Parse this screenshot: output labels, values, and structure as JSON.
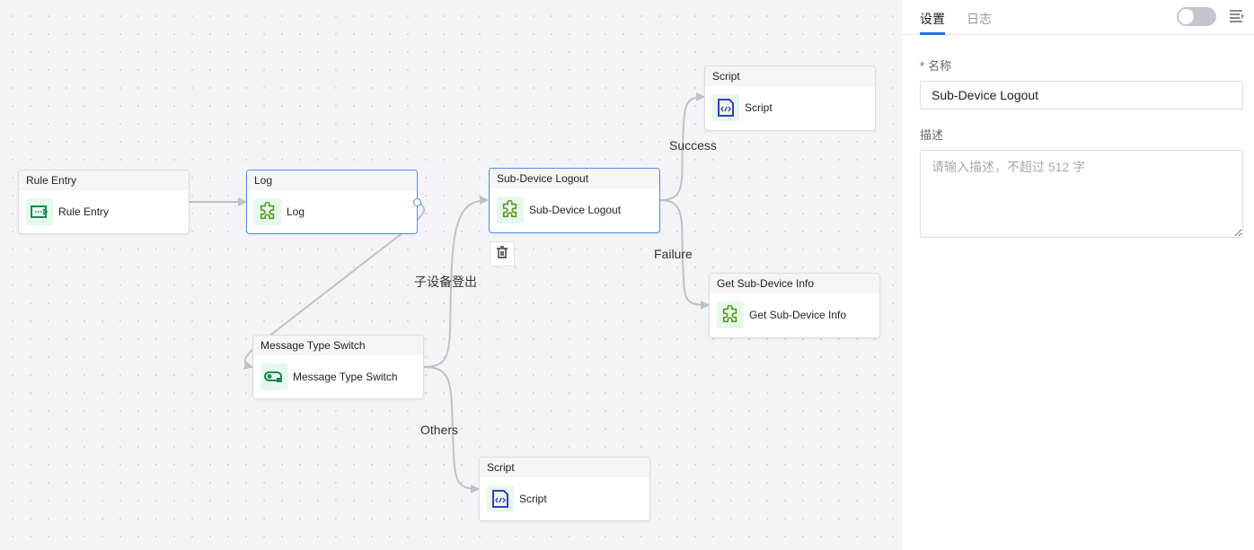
{
  "canvas": {
    "nodes": [
      {
        "id": "rule-entry",
        "title": "Rule Entry",
        "label": "Rule Entry",
        "icon": "rule-entry-icon",
        "selected": false
      },
      {
        "id": "log",
        "title": "Log",
        "label": "Log",
        "icon": "puzzle-icon",
        "selected": false
      },
      {
        "id": "sub-device-logout",
        "title": "Sub-Device Logout",
        "label": "Sub-Device Logout",
        "icon": "puzzle-icon",
        "selected": true
      },
      {
        "id": "script-top",
        "title": "Script",
        "label": "Script",
        "icon": "script-icon",
        "selected": false
      },
      {
        "id": "get-sub-device-info",
        "title": "Get Sub-Device Info",
        "label": "Get Sub-Device Info",
        "icon": "puzzle-icon",
        "selected": false
      },
      {
        "id": "message-type-switch",
        "title": "Message Type Switch",
        "label": "Message Type Switch",
        "icon": "switch-icon",
        "selected": false
      },
      {
        "id": "script-bottom",
        "title": "Script",
        "label": "Script",
        "icon": "script-icon",
        "selected": false
      }
    ],
    "edges": [
      {
        "from": "rule-entry",
        "to": "log",
        "label": ""
      },
      {
        "from": "log",
        "to": "message-type-switch",
        "label": ""
      },
      {
        "from": "message-type-switch",
        "to": "sub-device-logout",
        "label": "子设备登出"
      },
      {
        "from": "message-type-switch",
        "to": "script-bottom",
        "label": "Others"
      },
      {
        "from": "sub-device-logout",
        "to": "script-top",
        "label": "Success"
      },
      {
        "from": "sub-device-logout",
        "to": "get-sub-device-info",
        "label": "Failure"
      }
    ],
    "delete_button_icon": "trash-icon"
  },
  "panel": {
    "tabs": [
      {
        "label": "设置",
        "active": true
      },
      {
        "label": "日志",
        "active": false
      }
    ],
    "toggle_on": false,
    "collapse_icon": "collapse-panel-icon",
    "name_field": {
      "label": "名称",
      "required_mark": "*",
      "value": "Sub-Device Logout"
    },
    "description_field": {
      "label": "描述",
      "value": "",
      "placeholder": "请输入描述，不超过 512 字"
    }
  },
  "colors": {
    "accent": "#1f6ff0",
    "selected_border": "#4b8ff0",
    "edge": "#c0c0c8",
    "icon_bg": "#e6f7ec",
    "puzzle": "#5a9a1a",
    "rule_entry": "#1a8a55",
    "script": "#3b3bc4"
  }
}
